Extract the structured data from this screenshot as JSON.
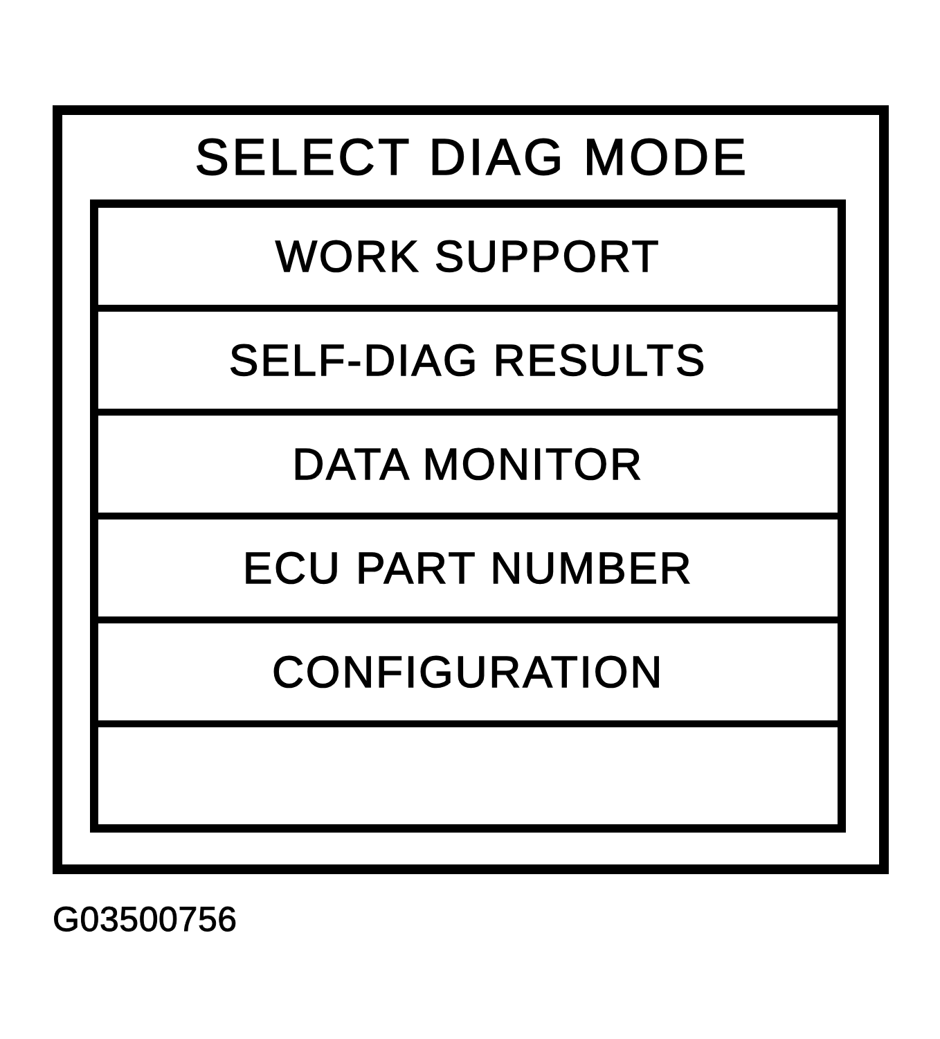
{
  "screen": {
    "title": "SELECT DIAG MODE",
    "menu_items": [
      {
        "kind": "option",
        "label": "WORK SUPPORT"
      },
      {
        "kind": "option",
        "label": "SELF-DIAG RESULTS"
      },
      {
        "kind": "option",
        "label": "DATA MONITOR"
      },
      {
        "kind": "option",
        "label": "ECU PART NUMBER"
      },
      {
        "kind": "option",
        "label": "CONFIGURATION"
      },
      {
        "kind": "blank"
      }
    ]
  },
  "figure_id": "G03500756"
}
